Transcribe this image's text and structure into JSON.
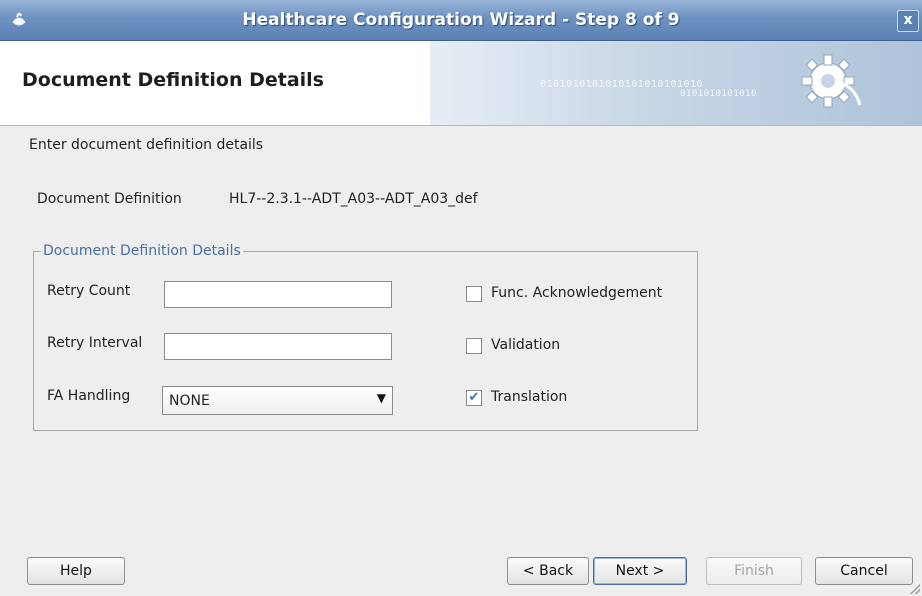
{
  "window": {
    "title": "Healthcare Configuration Wizard - Step 8 of 9",
    "close_glyph": "x"
  },
  "header": {
    "title": "Document Definition Details",
    "art_binary_1": "0101010101010101010101010",
    "art_binary_2": "0101010101010"
  },
  "main": {
    "instruction": "Enter document definition details",
    "doc_def_label": "Document Definition",
    "doc_def_value": "HL7--2.3.1--ADT_A03--ADT_A03_def"
  },
  "group": {
    "title": "Document Definition Details",
    "retry_count": {
      "label": "Retry Count",
      "value": ""
    },
    "retry_interval": {
      "label": "Retry Interval",
      "value": ""
    },
    "fa_handling": {
      "label": "FA Handling",
      "selected": "NONE"
    },
    "checkboxes": [
      {
        "label": "Func. Acknowledgement",
        "checked": false
      },
      {
        "label": "Validation",
        "checked": false
      },
      {
        "label": "Translation",
        "checked": true
      }
    ]
  },
  "buttons": {
    "help": "Help",
    "back": "< Back",
    "next": "Next >",
    "finish": "Finish",
    "cancel": "Cancel"
  },
  "colors": {
    "titlebar": "#6d92c2",
    "group_title": "#4a6fa5",
    "check": "#3d6fc2"
  }
}
